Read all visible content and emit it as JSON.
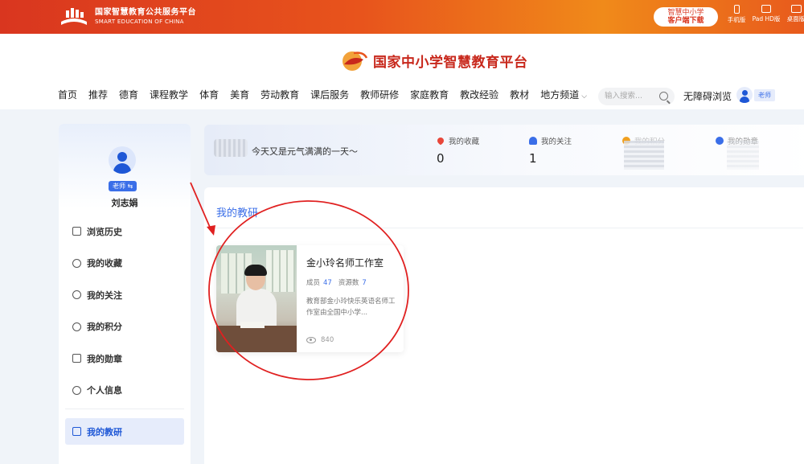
{
  "topbar": {
    "logo_title": "国家智慧教育公共服务平台",
    "logo_subtitle": "SMART EDUCATION OF CHINA",
    "download_line1": "智慧中小学",
    "download_line2": "客户端下载",
    "devices": [
      "手机版",
      "Pad HD版",
      "桌面版"
    ]
  },
  "header": {
    "brand_title": "国家中小学智慧教育平台",
    "nav": [
      "首页",
      "推荐",
      "德育",
      "课程教学",
      "体育",
      "美育",
      "劳动教育",
      "课后服务",
      "教师研修",
      "家庭教育",
      "教改经验",
      "教材",
      "地方频道"
    ],
    "search_placeholder": "输入搜索...",
    "accessibility": "无障碍浏览",
    "user_role": "老师"
  },
  "sidebar": {
    "role_badge": "老师 ⇆",
    "user_name": "刘志娟",
    "items": [
      {
        "label": "浏览历史",
        "icon": "file-icon"
      },
      {
        "label": "我的收藏",
        "icon": "heart-icon"
      },
      {
        "label": "我的关注",
        "icon": "user-follow-icon"
      },
      {
        "label": "我的积分",
        "icon": "points-icon"
      },
      {
        "label": "我的勋章",
        "icon": "medal-icon"
      },
      {
        "label": "个人信息",
        "icon": "check-circle-icon"
      },
      {
        "label": "我的教研",
        "icon": "calendar-icon"
      }
    ],
    "active_item": "我的教研"
  },
  "stats": {
    "greeting": "今天又是元气满满的一天～",
    "items": [
      {
        "label": "我的收藏",
        "value": "0",
        "icon": "heart-icon",
        "color": "#e8463a"
      },
      {
        "label": "我的关注",
        "value": "1",
        "icon": "user-icon",
        "color": "#3a6ee8"
      },
      {
        "label": "我的积分",
        "value": "",
        "icon": "points-icon",
        "color": "#f0a020"
      },
      {
        "label": "我的勋章",
        "value": "",
        "icon": "medal-icon",
        "color": "#3a6ee8"
      }
    ]
  },
  "main": {
    "section_title": "我的教研",
    "card": {
      "name": "金小玲名师工作室",
      "members_label": "成员",
      "members": "47",
      "resources_label": "资源数",
      "resources": "7",
      "description": "教育部金小玲快乐英语名师工作室由全国中小学...",
      "views": "840"
    }
  },
  "colors": {
    "accent": "#3a6ee8",
    "brand_red": "#c8281c",
    "annotation": "#e02020"
  }
}
